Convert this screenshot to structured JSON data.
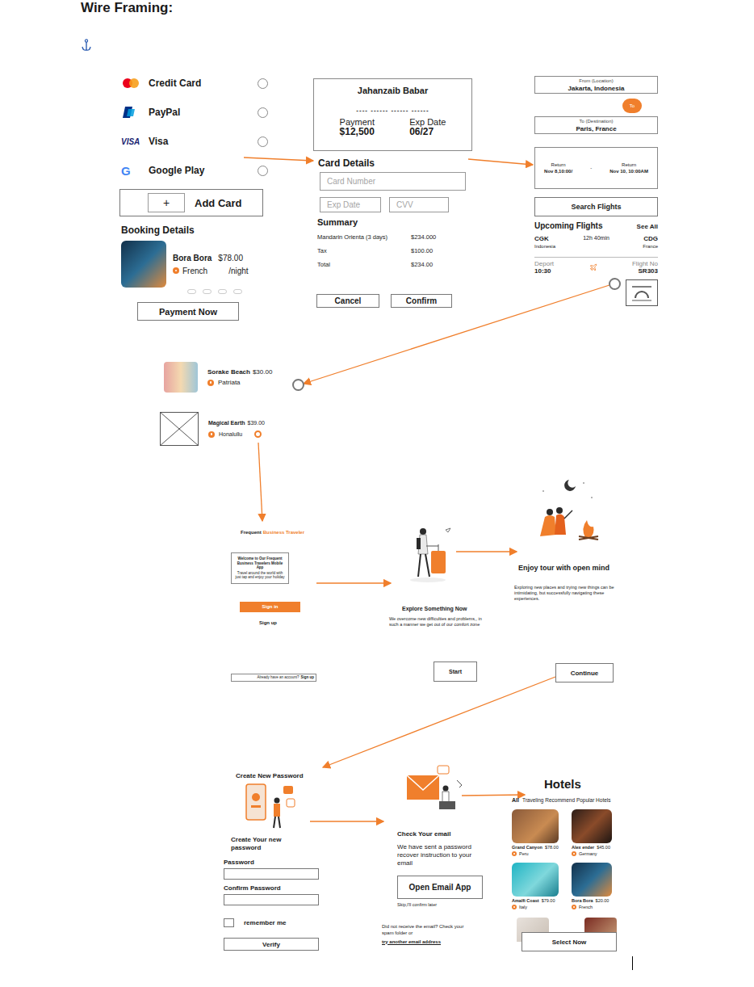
{
  "heading": "Wire Framing:",
  "payment_screen": {
    "methods": [
      {
        "name": "Credit Card",
        "kind": "mastercard",
        "selected": false
      },
      {
        "name": "PayPal",
        "kind": "paypal",
        "selected": false
      },
      {
        "name": "Visa",
        "kind": "visa",
        "logo_text": "VISA",
        "selected": false
      },
      {
        "name": "Google Play",
        "kind": "google",
        "logo_text": "G",
        "selected": false
      }
    ],
    "add_card": {
      "icon": "+",
      "label": "Add Card"
    },
    "booking_title": "Booking Details",
    "booking": {
      "name": "Bora Bora",
      "price": "$78.00",
      "location": "French",
      "unit": "/night"
    },
    "pay_button": "Payment Now"
  },
  "card_screen": {
    "card": {
      "holder": "Jahanzaib Babar",
      "number": "---- ------ ------ ------",
      "payment_label": "Payment",
      "payment": "$12,500",
      "exp_label": "Exp Date",
      "exp": "06/27"
    },
    "title": "Card Details",
    "fields": {
      "number": "Card Number",
      "exp": "Exp Date",
      "cvv": "CVV"
    },
    "summary_title": "Summary",
    "summary": [
      {
        "label": "Mandarin Orienta (3 days)",
        "value": "$234.000"
      },
      {
        "label": "Tax",
        "value": "$100.00"
      },
      {
        "label": "Total",
        "value": "$234.00"
      }
    ],
    "buttons": [
      "Cancel",
      "Confirm"
    ]
  },
  "flight_screen": {
    "from": {
      "label": "From (Location)",
      "value": "Jakarta, Indonesia"
    },
    "swap": "To",
    "to": {
      "label": "To (Destination)",
      "value": "Paris, France"
    },
    "dates": [
      {
        "label": "Return",
        "value": "Nov 8,10:00/"
      },
      {
        "label": "Return",
        "value": "Nov 10, 10:00AM"
      }
    ],
    "dates_separator": "-",
    "search": "Search Flights",
    "upcoming_title": "Upcoming Flights",
    "see_all": "See All",
    "flight": {
      "from_code": "CGK",
      "duration": "12h 40min",
      "to_code": "CDG",
      "from_country": "Indonesia",
      "to_country": "France",
      "depart_label": "Deport",
      "depart": "10:30",
      "number_label": "Flight No",
      "number": "SR303"
    }
  },
  "places": [
    {
      "name": "Sorake Beach",
      "price": "$30.00",
      "location": "Patriata",
      "kind": "photo"
    },
    {
      "name": "Magical Earth",
      "price": "$39.00",
      "location": "Honalullu",
      "kind": "placeholder"
    }
  ],
  "welcome_screen": {
    "brand_first": "Frequent",
    "brand_accent": "Business Traveler",
    "welcome_title": "Welcome to Our Frequent Business Travelers Mobile App",
    "welcome_text": "Travel around the world with just tap and enjoy your holiday",
    "sign_in": "Sign in",
    "sign_up": "Sign up",
    "account_prompt": "Already have an account?",
    "account_link": "Sign up"
  },
  "explore_screen": {
    "title": "Explore Something Now",
    "text": "We overcome new difficulties and problems,, in such a manner we get out of our comfort zone",
    "button": "Start"
  },
  "enjoy_screen": {
    "title": "Enjoy tour with open mind",
    "text": "Exploring new places and trying new things can be intimidating, but successfully navigating these experiences.",
    "button": "Continue"
  },
  "password_screen": {
    "heading": "Create New Password",
    "title": "Create Your new password",
    "fields": [
      {
        "label": "Password"
      },
      {
        "label": "Confirm  Password"
      }
    ],
    "remember": {
      "label": "remember me",
      "checked": false
    },
    "button": "Verify"
  },
  "email_screen": {
    "title": "Check Your email",
    "text": "We have sent a password recover instruction to your email",
    "button": "Open Email App",
    "skip": "Skip,I'll confirm later",
    "help": "Did not receive the email? Check your spam folder or",
    "link": "try another email address"
  },
  "hotels_screen": {
    "title": "Hotels",
    "filter_all": "All",
    "filter_text": "Traveling Recommend Popular Hotels",
    "items": [
      {
        "name": "Grand Canyon",
        "price": "$78.00",
        "location": "Peru"
      },
      {
        "name": "Alex ender",
        "price": "$45.00",
        "location": "Germany"
      },
      {
        "name": "Amalfi Coast",
        "price": "$79.00",
        "location": "Italy"
      },
      {
        "name": "Bora Bora",
        "price": "$20.00",
        "location": "French"
      }
    ],
    "button": "Select Now"
  }
}
